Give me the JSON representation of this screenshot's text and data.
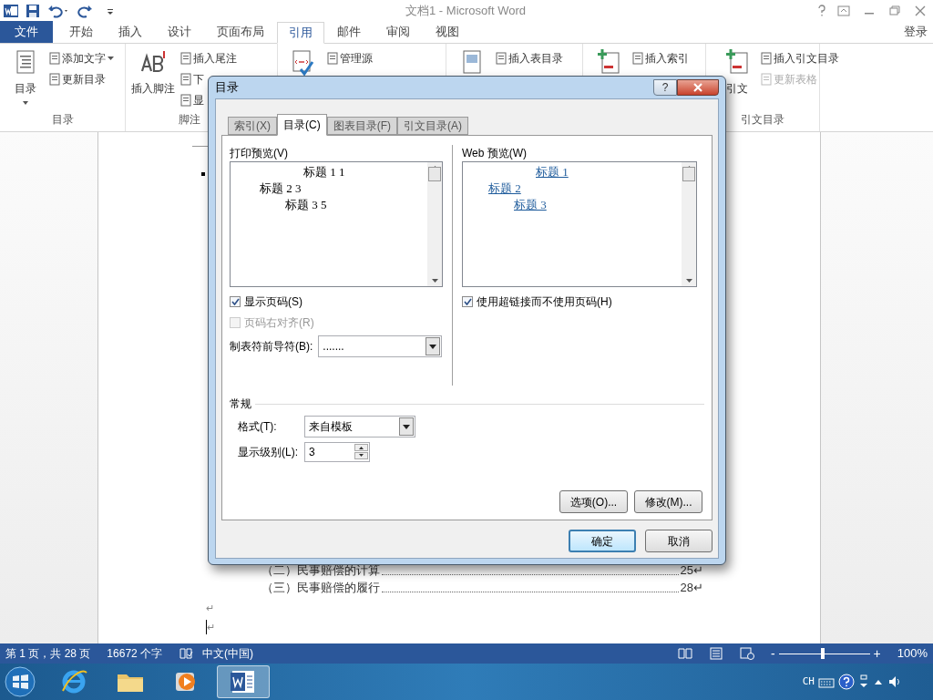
{
  "window": {
    "title": "文档1 - Microsoft Word"
  },
  "ribbon_tabs": [
    {
      "label": "文件",
      "kind": "file",
      "selected": false
    },
    {
      "label": "开始",
      "kind": "tab",
      "selected": false
    },
    {
      "label": "插入",
      "kind": "tab",
      "selected": false
    },
    {
      "label": "设计",
      "kind": "tab",
      "selected": false
    },
    {
      "label": "页面布局",
      "kind": "tab",
      "selected": false
    },
    {
      "label": "引用",
      "kind": "tab",
      "selected": true
    },
    {
      "label": "邮件",
      "kind": "tab",
      "selected": false
    },
    {
      "label": "审阅",
      "kind": "tab",
      "selected": false
    },
    {
      "label": "视图",
      "kind": "tab",
      "selected": false
    }
  ],
  "sign_in": "登录",
  "ribbon_groups": [
    {
      "label": "目录",
      "large": {
        "label": "目录",
        "kind": "toc"
      },
      "items": [
        {
          "label": "添加文字",
          "disabled": false,
          "dropdown": true
        },
        {
          "label": "更新目录",
          "disabled": false,
          "dropdown": false
        }
      ]
    },
    {
      "label": "脚注",
      "large": {
        "label": "插入脚注",
        "kind": "footnote"
      },
      "items": [
        {
          "label": "插入尾注",
          "disabled": false,
          "dropdown": false
        },
        {
          "label": "下",
          "disabled": false,
          "dropdown": false
        },
        {
          "label": "显",
          "disabled": false,
          "dropdown": false
        }
      ]
    },
    {
      "large": {
        "kind": "citation"
      },
      "items": [
        {
          "label": "管理源",
          "disabled": false,
          "dropdown": false
        }
      ]
    },
    {
      "large": {
        "kind": "caption"
      },
      "items": [
        {
          "label": "插入表目录",
          "disabled": false,
          "dropdown": false
        }
      ]
    },
    {
      "large": {
        "kind": "index"
      },
      "items": [
        {
          "label": "插入索引",
          "disabled": false,
          "dropdown": false
        }
      ]
    },
    {
      "label": "引文目录",
      "large": {
        "label": "引文",
        "kind": "authorities"
      },
      "items": [
        {
          "label": "插入引文目录",
          "disabled": false,
          "dropdown": false
        },
        {
          "label": "更新表格",
          "disabled": true,
          "dropdown": false
        }
      ]
    }
  ],
  "document": {
    "lines": [
      {
        "text": "（二）民事赔偿的计算",
        "page": "25↵"
      },
      {
        "text": "（三）民事赔偿的履行",
        "page": "28↵"
      }
    ],
    "marks": [
      "↵",
      "↵"
    ]
  },
  "dialog": {
    "title": "目录",
    "help": "?",
    "tabs": [
      {
        "label": "索引(X)",
        "selected": false
      },
      {
        "label": "目录(C)",
        "selected": true
      },
      {
        "label": "图表目录(F)",
        "selected": false
      },
      {
        "label": "引文目录(A)",
        "selected": false
      }
    ],
    "print_preview": {
      "label": "打印预览(V)",
      "entries": [
        {
          "text": "标题 1",
          "page": "1",
          "children": [
            {
              "text": "标题 2",
              "page": "3",
              "children": [
                {
                  "text": "标题 3",
                  "page": "5"
                }
              ]
            }
          ]
        }
      ]
    },
    "web_preview": {
      "label": "Web 预览(W)",
      "entries": [
        {
          "text": "标题 1",
          "children": [
            {
              "text": "标题 2",
              "children": [
                {
                  "text": "标题 3"
                }
              ]
            }
          ]
        }
      ]
    },
    "left_options": [
      {
        "label": "显示页码(S)",
        "checked": true,
        "disabled": false
      },
      {
        "label": "页码右对齐(R)",
        "checked": false,
        "disabled": true
      }
    ],
    "tab_leader": {
      "label": "制表符前导符(B):",
      "value": "......."
    },
    "right_options": [
      {
        "label": "使用超链接而不使用页码(H)",
        "checked": true,
        "disabled": false
      }
    ],
    "general": {
      "label": "常规",
      "format": {
        "label": "格式(T):",
        "value": "来自模板"
      },
      "levels": {
        "label": "显示级别(L):",
        "value": "3"
      }
    },
    "buttons": [
      {
        "label": "选项(O)...",
        "default": false
      },
      {
        "label": "修改(M)...",
        "default": false
      }
    ],
    "footer_buttons": [
      {
        "label": "确定",
        "default": true
      },
      {
        "label": "取消",
        "default": false
      }
    ]
  },
  "status_bar": {
    "page": "第 1 页，共 28 页",
    "words": "16672 个字",
    "language": "中文(中国)",
    "zoom_out": "-",
    "zoom_in": "+",
    "zoom": {
      "level": 0.48
    },
    "zoom_text": "100%"
  },
  "taskbar": {
    "apps": [
      {
        "kind": "ie",
        "active": false
      },
      {
        "kind": "explorer",
        "active": false
      },
      {
        "kind": "media",
        "active": false
      },
      {
        "kind": "word",
        "active": true
      }
    ],
    "lang": "CH"
  }
}
